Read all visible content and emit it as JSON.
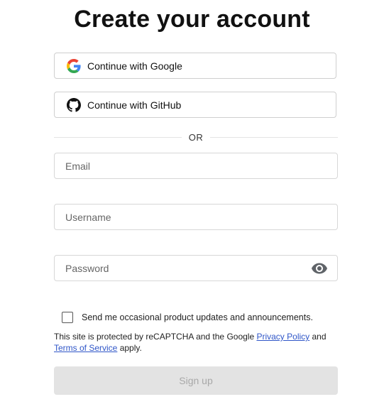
{
  "page": {
    "title": "Create your account"
  },
  "oauth": {
    "google_label": "Continue with Google",
    "google_icon": "google-icon",
    "github_label": "Continue with GitHub",
    "github_icon": "github-icon"
  },
  "divider": {
    "text": "OR"
  },
  "form": {
    "email": {
      "placeholder": "Email",
      "value": ""
    },
    "username": {
      "placeholder": "Username",
      "value": ""
    },
    "password": {
      "placeholder": "Password",
      "value": "",
      "toggle_icon": "eye-icon"
    },
    "updates_checkbox": {
      "label": "Send me occasional product updates and announcements.",
      "checked": false
    }
  },
  "legal": {
    "prefix": "This site is protected by reCAPTCHA and the Google ",
    "privacy_link": "Privacy Policy",
    "middle": " and",
    "terms_link": "Terms of Service",
    "suffix": " apply."
  },
  "actions": {
    "signup_label": "Sign up"
  },
  "colors": {
    "link": "#2f56c8",
    "disabled_button_bg": "#e3e3e3",
    "disabled_button_text": "#a8a8a8"
  }
}
